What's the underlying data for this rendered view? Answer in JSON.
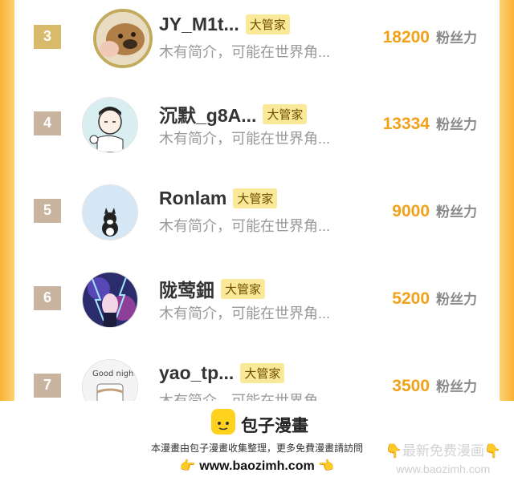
{
  "rows": [
    {
      "rank": "3",
      "username": "JY_M1t...",
      "tag": "大管家",
      "intro": "木有简介，可能在世界角...",
      "fans_count": "18200",
      "fans_label": "粉丝力"
    },
    {
      "rank": "4",
      "username": "沉默_g8A...",
      "tag": "大管家",
      "intro": "木有简介，可能在世界角...",
      "fans_count": "13334",
      "fans_label": "粉丝力"
    },
    {
      "rank": "5",
      "username": "Ronlam",
      "tag": "大管家",
      "intro": "木有简介，可能在世界角...",
      "fans_count": "9000",
      "fans_label": "粉丝力"
    },
    {
      "rank": "6",
      "username": "陇莺鈿",
      "tag": "大管家",
      "intro": "木有简介，可能在世界角...",
      "fans_count": "5200",
      "fans_label": "粉丝力"
    },
    {
      "rank": "7",
      "username": "yao_tp...",
      "tag": "大管家",
      "intro": "木有简介，可能在世界角...",
      "fans_count": "3500",
      "fans_label": "粉丝力"
    }
  ],
  "avatar_caption": "Good night",
  "footer": {
    "logo_text": "包子漫畫",
    "notice": "本漫畫由包子漫畫收集整理，更多免費漫畫請訪問",
    "url": "www.baozimh.com",
    "hand_left": "👉",
    "hand_right": "👈",
    "watermark_title": "👇最新免费漫画👇",
    "watermark_url": "www.baozimh.com"
  },
  "colors": {
    "accent_orange": "#f9b233",
    "fans_count": "#f2a21a",
    "tag_bg": "#fbe99a",
    "rank_gold": "#d8ba6c",
    "rank_bronze": "#c9b49f"
  }
}
